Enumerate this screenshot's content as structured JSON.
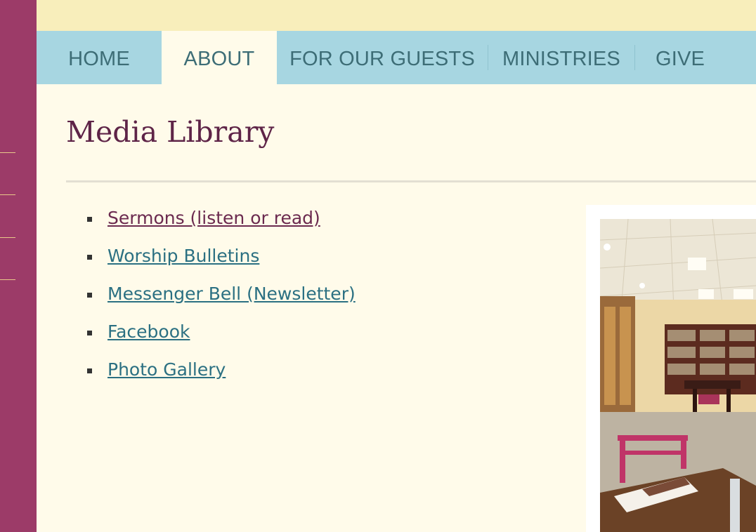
{
  "nav": {
    "items": [
      {
        "label": "HOME",
        "active": false
      },
      {
        "label": "ABOUT",
        "active": true
      },
      {
        "label": "FOR OUR GUESTS",
        "active": false
      },
      {
        "label": "MINISTRIES",
        "active": false
      },
      {
        "label": "GIVE",
        "active": false
      }
    ]
  },
  "page": {
    "title": "Media Library"
  },
  "links": [
    {
      "label": "Sermons (listen or read)",
      "visited": true
    },
    {
      "label": "Worship Bulletins",
      "visited": false
    },
    {
      "label": "Messenger Bell (Newsletter)",
      "visited": false
    },
    {
      "label": "Facebook",
      "visited": false
    },
    {
      "label": "Photo Gallery",
      "visited": false
    }
  ],
  "colors": {
    "sidebar": "#9c3b68",
    "nav_bar": "#a7d6e1",
    "top_band": "#f8eebb",
    "page_background": "#fffbea",
    "title": "#5e2447",
    "link": "#2b7082",
    "visited_link": "#6b2a4f"
  },
  "photo": {
    "subject": "church-library-room-image"
  }
}
